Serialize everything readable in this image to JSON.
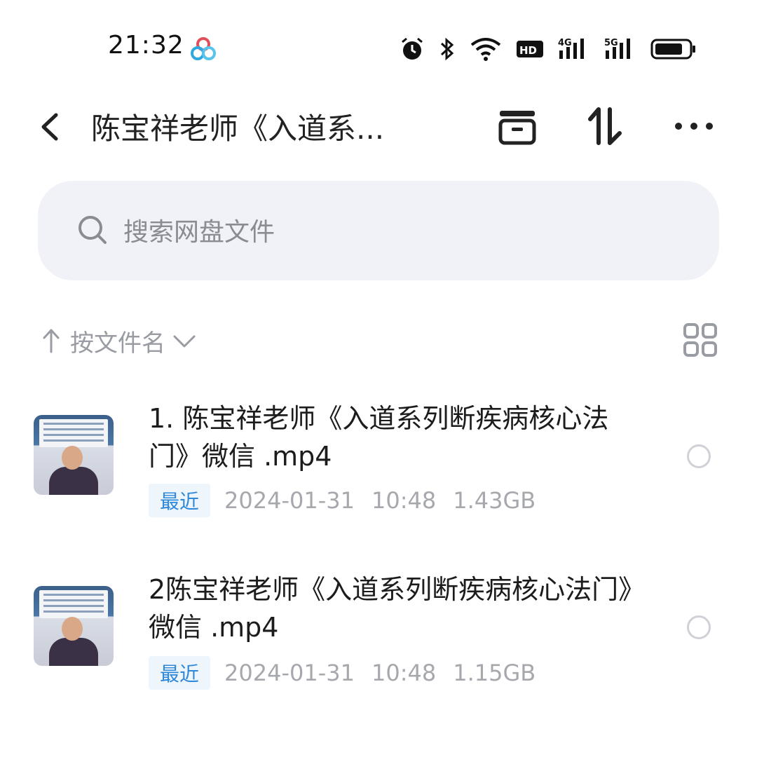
{
  "status_bar": {
    "time": "21:32",
    "icons": [
      "app-logo-icon",
      "alarm-icon",
      "bluetooth-icon",
      "wifi-icon",
      "hd-icon",
      "4g-signal-icon",
      "5g-signal-icon",
      "battery-icon"
    ],
    "network_4g": "4G",
    "network_5g": "5G",
    "hd": "HD"
  },
  "header": {
    "title": "陈宝祥老师《入道系...",
    "icons": [
      "back-icon",
      "archive-icon",
      "sort-icon",
      "more-icon"
    ]
  },
  "search": {
    "placeholder": "搜索网盘文件"
  },
  "sort": {
    "label": "按文件名",
    "icons": [
      "sort-ascending-icon",
      "chevron-down-icon",
      "grid-view-icon"
    ]
  },
  "files": [
    {
      "name": "1. 陈宝祥老师《入道系列断疾病核心法门》微信 .mp4",
      "badge": "最近",
      "date": "2024-01-31",
      "time": "10:48",
      "size": "1.43GB"
    },
    {
      "name": "2陈宝祥老师《入道系列断疾病核心法门》微信 .mp4",
      "badge": "最近",
      "date": "2024-01-31",
      "time": "10:48",
      "size": "1.15GB"
    }
  ],
  "colors": {
    "accent": "#2f88d9",
    "search_bg": "#f1f2f7",
    "meta_text": "#a6a8ad"
  }
}
